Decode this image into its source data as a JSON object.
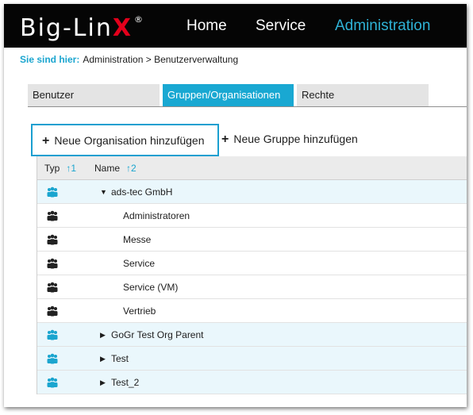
{
  "app": {
    "logo_main": "Big-Lin",
    "logo_accent": "X",
    "logo_mark": "®"
  },
  "nav": {
    "items": [
      {
        "label": "Home",
        "active": false
      },
      {
        "label": "Service",
        "active": false
      },
      {
        "label": "Administration",
        "active": true
      }
    ]
  },
  "breadcrumb": {
    "label": "Sie sind hier:",
    "path": "Administration > Benutzerverwaltung"
  },
  "tabs": [
    {
      "label": "Benutzer",
      "active": false
    },
    {
      "label": "Gruppen/Organisationen",
      "active": true
    },
    {
      "label": "Rechte",
      "active": false
    }
  ],
  "actions": {
    "add_org": "Neue Organisation hinzufügen",
    "add_group": "Neue Gruppe hinzufügen",
    "plus_symbol": "+"
  },
  "table": {
    "columns": [
      {
        "label": "Typ",
        "sort": "↑1"
      },
      {
        "label": "Name",
        "sort": "↑2"
      }
    ],
    "rows": [
      {
        "name": "ads-tec GmbH",
        "kind": "organization",
        "caret": "▼",
        "level": 0
      },
      {
        "name": "Administratoren",
        "kind": "group",
        "caret": "",
        "level": 1
      },
      {
        "name": "Messe",
        "kind": "group",
        "caret": "",
        "level": 1
      },
      {
        "name": "Service",
        "kind": "group",
        "caret": "",
        "level": 1
      },
      {
        "name": "Service (VM)",
        "kind": "group",
        "caret": "",
        "level": 1
      },
      {
        "name": "Vertrieb",
        "kind": "group",
        "caret": "",
        "level": 1
      },
      {
        "name": "GoGr Test Org Parent",
        "kind": "organization",
        "caret": "▶",
        "level": 0
      },
      {
        "name": "Test",
        "kind": "organization",
        "caret": "▶",
        "level": 0
      },
      {
        "name": "Test_2",
        "kind": "organization",
        "caret": "▶",
        "level": 0
      }
    ]
  },
  "colors": {
    "topbar": "#050505",
    "accent": "#19a8d2",
    "logo_x": "#e3001b",
    "org_icon": "#1aa5cf",
    "group_icon": "#222222",
    "org_row_bg": "#eaf7fc"
  }
}
